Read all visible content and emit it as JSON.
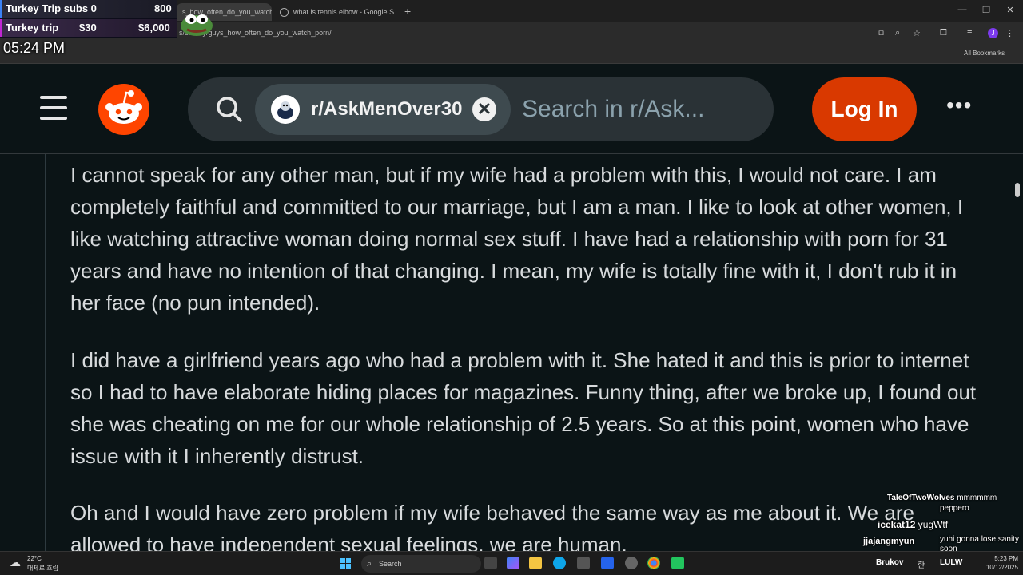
{
  "overlay": {
    "subs_label": "Turkey Trip subs 0",
    "subs_goal": "800",
    "trip_label": "Turkey trip",
    "trip_amount": "$30",
    "trip_goal": "$6,000",
    "clock": "05:24 PM"
  },
  "browser": {
    "tabs": [
      {
        "label": "s_how_often_do_you_watch_..."
      },
      {
        "label": "what is tennis elbow - Google S"
      }
    ],
    "url": "s/8f1d7y/guys_how_often_do_you_watch_porn/",
    "bookmarks_label": "All Bookmarks",
    "profile_initial": "J"
  },
  "header": {
    "community_chip": "r/AskMenOver30",
    "search_placeholder": "Search in r/Ask...",
    "login_label": "Log In",
    "more_label": "•••"
  },
  "post": {
    "paragraphs": [
      "I cannot speak for any other man, but if my wife had a problem with this, I would not care. I am completely faithful and committed to our marriage, but I am a man. I like to look at other women, I like watching attractive woman doing normal sex stuff. I have had a relationship with porn for 31 years and have no intention of that changing. I mean, my wife is totally fine with it, I don't rub it in her face (no pun intended).",
      "I did have a girlfriend years ago who had a problem with it. She hated it and this is prior to internet so I had to have elaborate hiding places for magazines. Funny thing, after we broke up, I found out she was cheating on me for our whole relationship of 2.5 years. So at this point, women who have issue with it I inherently distrust.",
      "Oh and I would have zero problem if my wife behaved the same way as me about it. We are allowed to have independent sexual feelings, we are human."
    ]
  },
  "chat": {
    "messages": [
      {
        "user": "TaleOfTwoWolves",
        "text": "mmmmmm"
      },
      {
        "user": "",
        "text": "peppero"
      },
      {
        "user": "icekat12",
        "text": "yugWtf"
      },
      {
        "user": "jjajangmyun",
        "text": "yuhi gonna lose sanity soon"
      }
    ]
  },
  "taskbar": {
    "weather_temp": "22°C",
    "weather_desc": "대체로 흐림",
    "search_label": "Search",
    "tray_user": "Brukov",
    "tray_emote": "LULW",
    "tray_ime": "한",
    "time": "5:23 PM",
    "date": "10/12/2025"
  },
  "colors": {
    "reddit_bg": "#0b1416",
    "login_button": "#d93900",
    "searchbox": "#2a3236"
  }
}
